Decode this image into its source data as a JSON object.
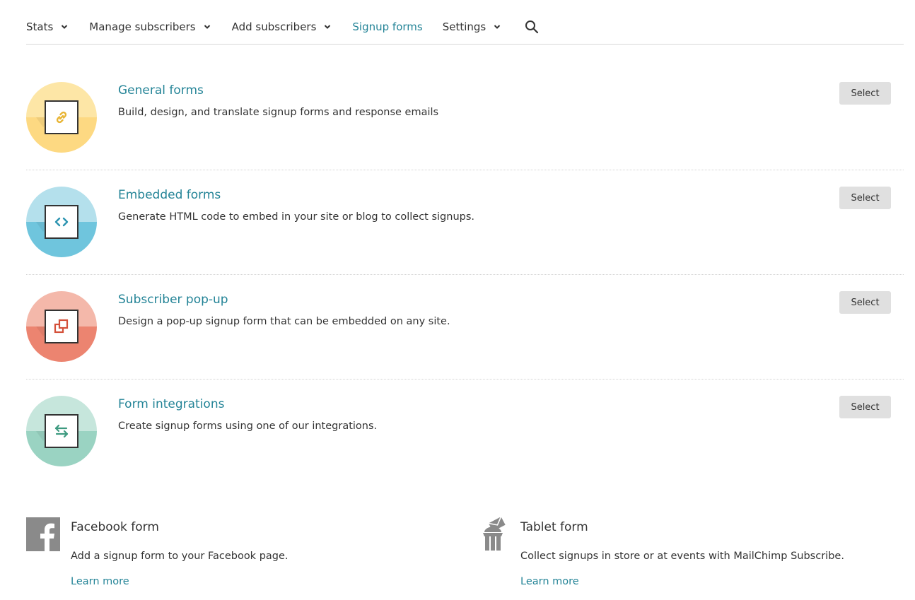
{
  "nav": {
    "items": [
      {
        "label": "Stats"
      },
      {
        "label": "Manage subscribers"
      },
      {
        "label": "Add subscribers"
      },
      {
        "label": "Signup forms"
      },
      {
        "label": "Settings"
      }
    ]
  },
  "options": [
    {
      "title": "General forms",
      "description": "Build, design, and translate signup forms and response emails",
      "button": "Select",
      "icon": "link-icon",
      "colors": {
        "top": "#fde6a6",
        "bottom": "#fdd982",
        "glyph": "#e8b432"
      }
    },
    {
      "title": "Embedded forms",
      "description": "Generate HTML code to embed in your site or blog to collect signups.",
      "button": "Select",
      "icon": "code-icon",
      "colors": {
        "top": "#b4e0ec",
        "bottom": "#6fc5dd",
        "glyph": "#2a93b0"
      }
    },
    {
      "title": "Subscriber pop-up",
      "description": "Design a pop-up signup form that can be embedded on any site.",
      "button": "Select",
      "icon": "popup-icon",
      "colors": {
        "top": "#f4b8aa",
        "bottom": "#ec8470",
        "glyph": "#d4503a"
      }
    },
    {
      "title": "Form integrations",
      "description": "Create signup forms using one of our integrations.",
      "button": "Select",
      "icon": "swap-arrows-icon",
      "colors": {
        "top": "#c6e6dc",
        "bottom": "#9ad3c2",
        "glyph": "#3e9a80"
      }
    }
  ],
  "cards": [
    {
      "title": "Facebook form",
      "description": "Add a signup form to your Facebook page.",
      "link": "Learn more",
      "icon": "facebook-icon"
    },
    {
      "title": "Tablet form",
      "description": "Collect signups in store or at events with MailChimp Subscribe.",
      "link": "Learn more",
      "icon": "tablet-form-icon"
    }
  ],
  "colors": {
    "accent": "#248497",
    "button_bg": "#e0e0e0"
  }
}
